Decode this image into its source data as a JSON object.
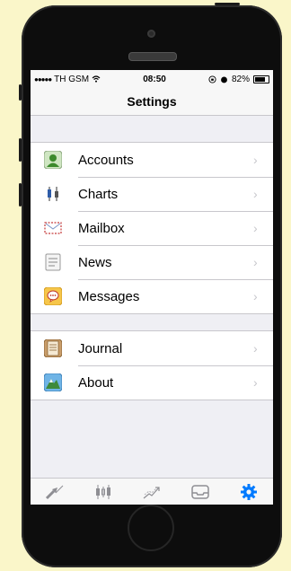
{
  "status": {
    "carrier": "TH GSM",
    "time": "08:50",
    "battery": "82%"
  },
  "navbar": {
    "title": "Settings"
  },
  "settings": {
    "group1": [
      {
        "label": "Accounts",
        "icon": "accounts-icon"
      },
      {
        "label": "Charts",
        "icon": "charts-icon"
      },
      {
        "label": "Mailbox",
        "icon": "mailbox-icon"
      },
      {
        "label": "News",
        "icon": "news-icon"
      },
      {
        "label": "Messages",
        "icon": "messages-icon"
      }
    ],
    "group2": [
      {
        "label": "Journal",
        "icon": "journal-icon"
      },
      {
        "label": "About",
        "icon": "about-icon"
      }
    ]
  },
  "tabbar": {
    "tabs": [
      "quotes-icon",
      "chart-icon",
      "trade-icon",
      "history-icon",
      "settings-gear-icon"
    ],
    "active_color": "#007aff",
    "inactive_color": "#8e8e93"
  }
}
